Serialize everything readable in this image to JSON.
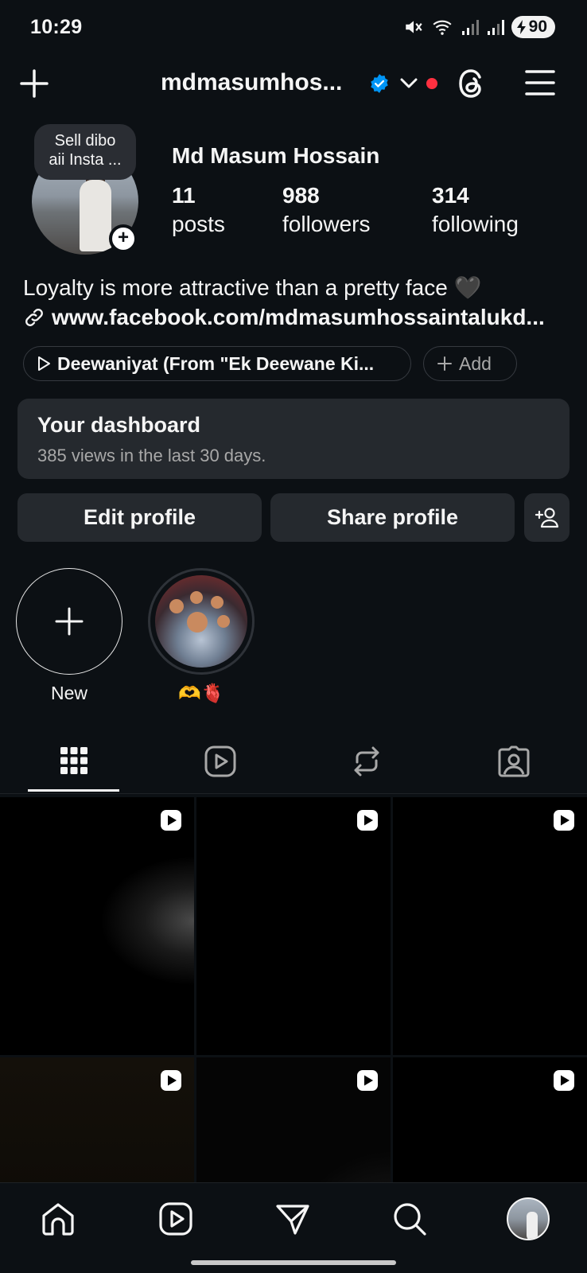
{
  "status_bar": {
    "time": "10:29",
    "battery": "90"
  },
  "header": {
    "username": "mdmasumhos..."
  },
  "profile": {
    "note": "Sell dibo aii Insta ...",
    "full_name": "Md Masum Hossain",
    "stats": {
      "posts": {
        "value": "11",
        "label": "posts"
      },
      "followers": {
        "value": "988",
        "label": "followers"
      },
      "following": {
        "value": "314",
        "label": "following"
      }
    },
    "bio": "Loyalty is more attractive than a pretty face 🖤",
    "link": "www.facebook.com/mdmasumhossaintalukd..."
  },
  "music": {
    "title": "Deewaniyat (From \"Ek Deewane Ki...",
    "add_label": "Add"
  },
  "dashboard": {
    "title": "Your dashboard",
    "subtitle": "385 views in the last 30 days."
  },
  "buttons": {
    "edit": "Edit profile",
    "share": "Share profile"
  },
  "highlights": [
    {
      "label": "New"
    },
    {
      "label": "🫶🫀"
    }
  ],
  "tabs": [
    "posts-grid",
    "reels",
    "reposts",
    "tagged"
  ],
  "bottom_nav": [
    "home",
    "reels",
    "messages",
    "search",
    "profile"
  ]
}
